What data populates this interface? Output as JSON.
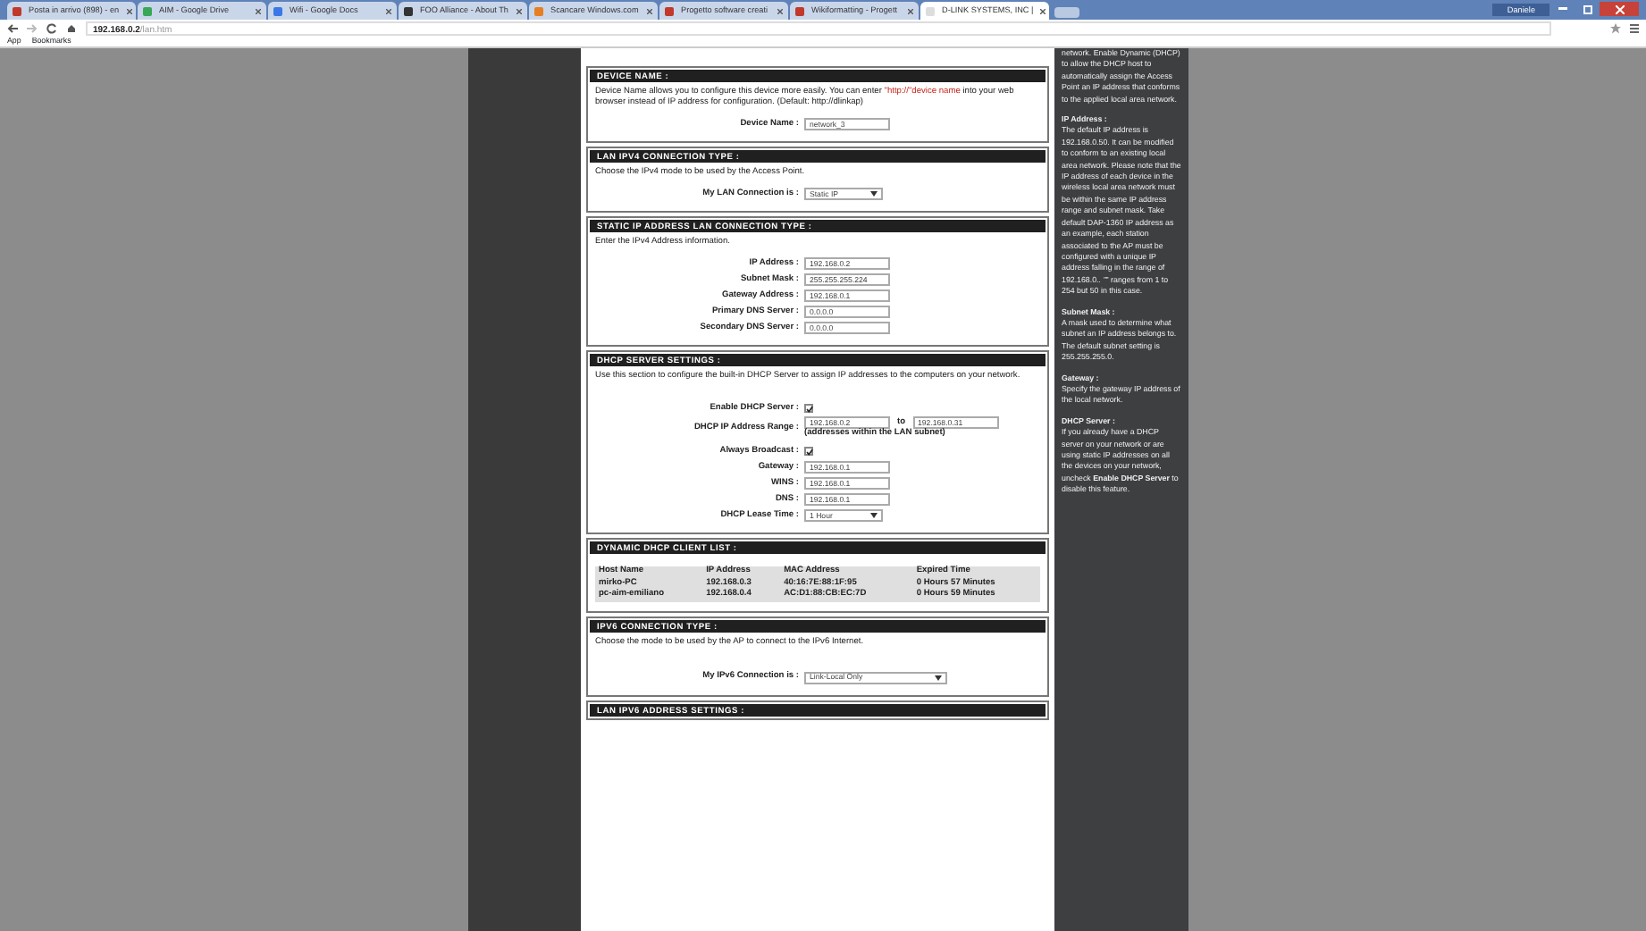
{
  "browser": {
    "tabs": [
      {
        "label": "Posta in arrivo (898) - en",
        "selected": false,
        "color": "#c0392b"
      },
      {
        "label": "AIM - Google Drive",
        "selected": false,
        "color": "#3aa757"
      },
      {
        "label": "Wifi - Google Docs",
        "selected": false,
        "color": "#3b78e7"
      },
      {
        "label": "FOO Alliance - About Th",
        "selected": false,
        "color": "#333333"
      },
      {
        "label": "Scancare Windows.com",
        "selected": false,
        "color": "#e67e22"
      },
      {
        "label": "Progetto software creati",
        "selected": false,
        "color": "#c0392b"
      },
      {
        "label": "Wikiformatting - Progett",
        "selected": false,
        "color": "#c0392b"
      },
      {
        "label": "D-LINK SYSTEMS, INC | ",
        "selected": true,
        "color": "#dddddd"
      }
    ],
    "user": "Daniele",
    "address": {
      "host": "192.168.0.2",
      "path": "/lan.htm"
    },
    "bookmarks": [
      "App",
      "Bookmarks"
    ]
  },
  "main": {
    "sections": [
      {
        "title": "DEVICE NAME :",
        "description": {
          "before": "Device Name allows you to configure this device more easily. You can enter ",
          "link": "\"http://\"device name",
          "after": " into your web browser instead of IP address for configuration. (Default: http://dlinkap)"
        },
        "rows": [
          {
            "kind": "input",
            "label": "Device Name :",
            "value": "network_3"
          }
        ]
      },
      {
        "title": "LAN IPV4 CONNECTION TYPE :",
        "description": {
          "before": "Choose the IPv4 mode to be used by the Access Point."
        },
        "rows": [
          {
            "kind": "select",
            "label": "My LAN Connection is :",
            "value": "Static IP"
          }
        ]
      },
      {
        "title": "STATIC IP ADDRESS LAN CONNECTION TYPE :",
        "description": {
          "before": "Enter the IPv4 Address information."
        },
        "rows": [
          {
            "kind": "input",
            "label": "IP Address :",
            "value": "192.168.0.2"
          },
          {
            "kind": "input",
            "label": "Subnet Mask :",
            "value": "255.255.255.224"
          },
          {
            "kind": "input",
            "label": "Gateway Address :",
            "value": "192.168.0.1"
          },
          {
            "kind": "input",
            "label": "Primary DNS Server :",
            "value": "0.0.0.0"
          },
          {
            "kind": "input",
            "label": "Secondary DNS Server :",
            "value": "0.0.0.0"
          }
        ]
      },
      {
        "title": "DHCP SERVER SETTINGS :",
        "description": {
          "before": "Use this section to configure the built-in DHCP Server to assign IP addresses to the computers on your network."
        },
        "rows": [
          {
            "kind": "checkbox",
            "label": "Enable DHCP Server :",
            "checked": true
          },
          {
            "kind": "range",
            "label": "DHCP IP Address Range :",
            "value": "192.168.0.2",
            "joiner": "to",
            "value_to": "192.168.0.31",
            "note": "(addresses within the LAN subnet)"
          },
          {
            "kind": "checkbox",
            "label": "Always Broadcast :",
            "checked": true
          },
          {
            "kind": "input",
            "label": "Gateway :",
            "value": "192.168.0.1"
          },
          {
            "kind": "input",
            "label": "WINS :",
            "value": "192.168.0.1"
          },
          {
            "kind": "input",
            "label": "DNS :",
            "value": "192.168.0.1"
          },
          {
            "kind": "select",
            "label": "DHCP Lease Time :",
            "value": "1 Hour"
          }
        ]
      },
      {
        "title": "DYNAMIC DHCP CLIENT LIST :",
        "table": {
          "columns": [
            "Host Name",
            "IP Address",
            "MAC Address",
            "Expired Time"
          ],
          "rows": [
            [
              "mirko-PC",
              "192.168.0.3",
              "40:16:7E:88:1F:95",
              "0 Hours 57 Minutes"
            ],
            [
              "pc-aim-emiliano",
              "192.168.0.4",
              "AC:D1:88:CB:EC:7D",
              "0 Hours 59 Minutes"
            ]
          ]
        }
      },
      {
        "title": "IPV6 CONNECTION TYPE :",
        "description": {
          "before": "Choose the mode to be used by the AP to connect to the IPv6 Internet."
        },
        "rows": [
          {
            "kind": "select",
            "label": "My IPv6 Connection is :",
            "value": "Link-Local Only",
            "wide": true
          }
        ]
      },
      {
        "title": "LAN IPV6 ADDRESS SETTINGS :"
      }
    ]
  },
  "help": [
    {
      "text": "network. Enable Dynamic (DHCP) to allow the DHCP host to automatically assign the Access Point an IP address that conforms to the applied local area network."
    },
    {
      "heading": "IP Address :",
      "text": "The default IP address is 192.168.0.50. It can be modified to conform to an existing local area network. Please note that the IP address of each device in the wireless local area network must be within the same IP address range and subnet mask. Take default DAP-1360 IP address as an example, each station associated to the AP must be configured with a unique IP address falling in the range of 192.168.0.*. \"*\" ranges from 1 to 254 but 50 in this case."
    },
    {
      "heading": "Subnet Mask :",
      "text": "A mask used to determine what subnet an IP address belongs to. The default subnet setting is 255.255.255.0."
    },
    {
      "heading": "Gateway :",
      "text": "Specify the gateway IP address of the local network."
    },
    {
      "heading": "DHCP Server :",
      "text": "If you already have a DHCP server on your network or are using static IP addresses on all the devices on your network, uncheck **Enable DHCP Server** to disable this feature."
    }
  ]
}
